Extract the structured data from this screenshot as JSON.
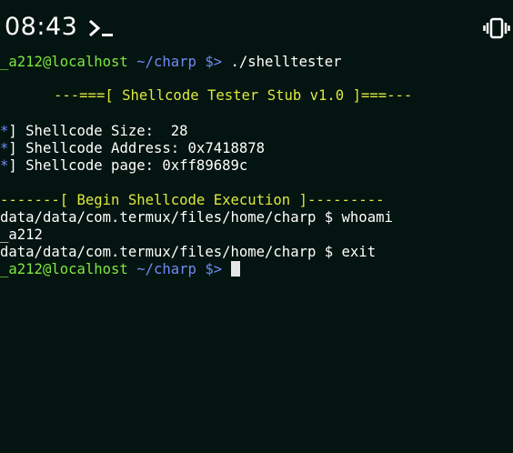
{
  "status_bar": {
    "time": "08:43",
    "terminal_icon": "terminal-prompt-icon",
    "vibrate_icon": "vibrate-mode-icon"
  },
  "terminal": {
    "prompt": {
      "user_host": "_a212@localhost",
      "path": "~/charp",
      "symbol": "$>"
    },
    "command_1": "./shelltester",
    "banner": "---===[ Shellcode Tester Stub v1.0 ]===---",
    "info": [
      {
        "mark": "*",
        "text": "] Shellcode Size:  28"
      },
      {
        "mark": "*",
        "text": "] Shellcode Address: 0x7418878"
      },
      {
        "mark": "*",
        "text": "] Shellcode page: 0xff89689c"
      }
    ],
    "exec_header": "-------[ Begin Shellcode Execution ]---------",
    "sub_prompt_1": "data/data/com.termux/files/home/charp $ whoami",
    "output_1": "_a212",
    "sub_prompt_2": "data/data/com.termux/files/home/charp $ exit"
  },
  "colors": {
    "background": "#041410",
    "prompt_green": "#7ee83f",
    "prompt_blue": "#6e8bf5",
    "banner_yellow": "#dde83f",
    "text_white": "#ffffff"
  }
}
